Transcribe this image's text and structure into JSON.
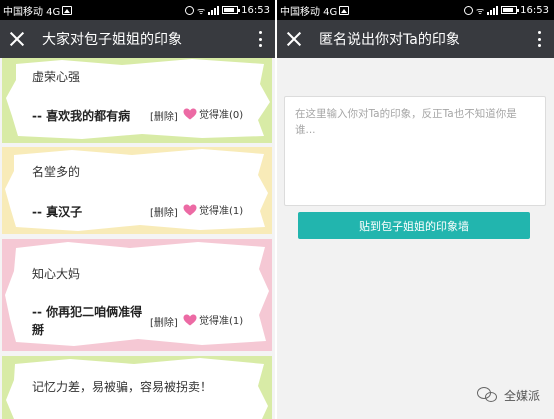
{
  "status_left": {
    "carrier": "中国移动 4G",
    "time": "16:53"
  },
  "status_right": {
    "carrier": "中国移动 4G",
    "time": "16:53"
  },
  "left_screen": {
    "title": "大家对包子姐姐的印象",
    "cards": [
      {
        "text": "虚荣心强",
        "author": "-- 喜欢我的都有病",
        "delete_label": "[删除]",
        "like_label": "觉得准(0)",
        "color": "#d8eba6"
      },
      {
        "text": "名堂多的",
        "author": "-- 真汉子",
        "delete_label": "[删除]",
        "like_label": "觉得准(1)",
        "color": "#f8ebb8"
      },
      {
        "text": "知心大妈",
        "author": "-- 你再犯二咱俩准得掰",
        "delete_label": "[删除]",
        "like_label": "觉得准(1)",
        "color": "#f5c8d4"
      },
      {
        "text": "记忆力差，易被骗，容易被拐卖！",
        "color": "#d8eba6"
      }
    ]
  },
  "right_screen": {
    "title": "匿名说出你对Ta的印象",
    "textarea_placeholder": "在这里输入你对Ta的印象，反正Ta也不知道你是谁...",
    "submit_label": "贴到包子姐姐的印象墙"
  },
  "watermark": "全媒派",
  "colors": {
    "titlebar": "#383a3f",
    "accent": "#22b5ae",
    "heart": "#ec6aa4"
  },
  "icons": [
    "close-icon",
    "more-vert-icon",
    "heart-icon",
    "alarm-icon",
    "wifi-icon",
    "signal-icon",
    "battery-icon"
  ]
}
